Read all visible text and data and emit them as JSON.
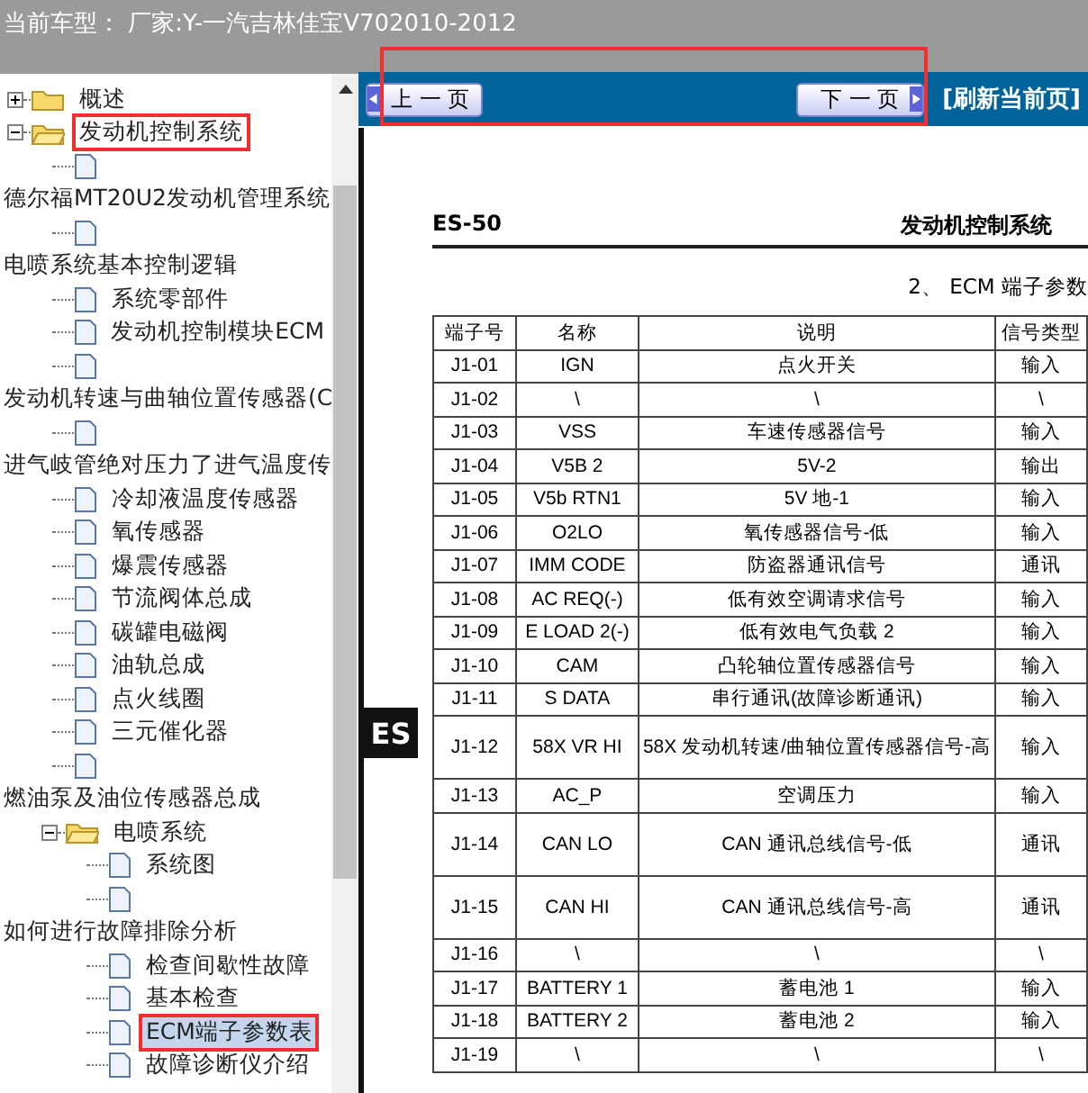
{
  "header": {
    "title": "当前车型： 厂家:Y-一汽吉林佳宝V702010-2012"
  },
  "tree": [
    {
      "kind": "folder",
      "label": "概述",
      "expanded": false,
      "selected": false,
      "highlighted": false
    },
    {
      "kind": "folder",
      "label": "发动机控制系统",
      "expanded": true,
      "selected": false,
      "highlighted": true,
      "children": [
        {
          "kind": "page-break",
          "label": "德尔福MT20U2发动机管理系统",
          "selected": false
        },
        {
          "kind": "page-break",
          "label": "电喷系统基本控制逻辑",
          "selected": false
        },
        {
          "kind": "page",
          "label": "系统零部件",
          "selected": false
        },
        {
          "kind": "page",
          "label": "发动机控制模块ECM",
          "selected": false
        },
        {
          "kind": "page-break",
          "label": "发动机转速与曲轴位置传感器(C",
          "selected": false
        },
        {
          "kind": "page-break",
          "label": "进气岐管绝对压力了进气温度传",
          "selected": false
        },
        {
          "kind": "page",
          "label": "冷却液温度传感器",
          "selected": false
        },
        {
          "kind": "page",
          "label": "氧传感器",
          "selected": false
        },
        {
          "kind": "page",
          "label": "爆震传感器",
          "selected": false
        },
        {
          "kind": "page",
          "label": "节流阀体总成",
          "selected": false
        },
        {
          "kind": "page",
          "label": "碳罐电磁阀",
          "selected": false
        },
        {
          "kind": "page",
          "label": "油轨总成",
          "selected": false
        },
        {
          "kind": "page",
          "label": "点火线圈",
          "selected": false
        },
        {
          "kind": "page",
          "label": "三元催化器",
          "selected": false
        },
        {
          "kind": "page-break",
          "label": "燃油泵及油位传感器总成",
          "selected": false
        },
        {
          "kind": "folder",
          "label": "电喷系统",
          "expanded": true,
          "selected": false,
          "highlighted": false,
          "children": [
            {
              "kind": "page",
              "label": "系统图",
              "selected": false
            },
            {
              "kind": "page-break",
              "label": "如何进行故障排除分析",
              "selected": false
            },
            {
              "kind": "page",
              "label": "检查间歇性故障",
              "selected": false
            },
            {
              "kind": "page",
              "label": "基本检查",
              "selected": false
            },
            {
              "kind": "page",
              "label": "ECM端子参数表",
              "selected": true,
              "highlighted": true
            },
            {
              "kind": "page",
              "label": "故障诊断仪介绍",
              "selected": false
            }
          ]
        }
      ]
    }
  ],
  "nav": {
    "prev": "上 一 页",
    "next": "下 一 页",
    "refresh": "[刷新当前页]",
    "highlighted": true
  },
  "document": {
    "page_code": "ES-50",
    "chapter": "发动机控制系统",
    "section_title": "2、 ECM 端子参数",
    "side_tab": "ES",
    "table": {
      "columns": [
        "端子号",
        "名称",
        "说明",
        "信号类型"
      ],
      "rows": [
        {
          "cells": [
            "J1-01",
            "IGN",
            "点火开关",
            "输入"
          ],
          "tall": false
        },
        {
          "cells": [
            "J1-02",
            "\\",
            "\\",
            "\\"
          ],
          "tall": false
        },
        {
          "cells": [
            "J1-03",
            "VSS",
            "车速传感器信号",
            "输入"
          ],
          "tall": false
        },
        {
          "cells": [
            "J1-04",
            "V5B 2",
            "5V-2",
            "输出"
          ],
          "tall": false
        },
        {
          "cells": [
            "J1-05",
            "V5b RTN1",
            "5V 地-1",
            "输入"
          ],
          "tall": false
        },
        {
          "cells": [
            "J1-06",
            "O2LO",
            "氧传感器信号-低",
            "输入"
          ],
          "tall": false
        },
        {
          "cells": [
            "J1-07",
            "IMM CODE",
            "防盗器通讯信号",
            "通讯"
          ],
          "tall": false
        },
        {
          "cells": [
            "J1-08",
            "AC REQ(-)",
            "低有效空调请求信号",
            "输入"
          ],
          "tall": false
        },
        {
          "cells": [
            "J1-09",
            "E LOAD 2(-)",
            "低有效电气负载 2",
            "输入"
          ],
          "tall": false
        },
        {
          "cells": [
            "J1-10",
            "CAM",
            "凸轮轴位置传感器信号",
            "输入"
          ],
          "tall": false
        },
        {
          "cells": [
            "J1-11",
            "S DATA",
            "串行通讯(故障诊断通讯)",
            "输入"
          ],
          "tall": false
        },
        {
          "cells": [
            "J1-12",
            "58X VR HI",
            "58X 发动机转速/曲轴位置传感器信号-高",
            "输入"
          ],
          "tall": true
        },
        {
          "cells": [
            "J1-13",
            "AC_P",
            "空调压力",
            "输入"
          ],
          "tall": false
        },
        {
          "cells": [
            "J1-14",
            "CAN LO",
            "CAN 通讯总线信号-低",
            "通讯"
          ],
          "tall": true
        },
        {
          "cells": [
            "J1-15",
            "CAN HI",
            "CAN 通讯总线信号-高",
            "通讯"
          ],
          "tall": true
        },
        {
          "cells": [
            "J1-16",
            "\\",
            "\\",
            "\\"
          ],
          "tall": false
        },
        {
          "cells": [
            "J1-17",
            "BATTERY 1",
            "蓄电池 1",
            "输入"
          ],
          "tall": false
        },
        {
          "cells": [
            "J1-18",
            "BATTERY 2",
            "蓄电池 2",
            "输入"
          ],
          "tall": false
        },
        {
          "cells": [
            "J1-19",
            "\\",
            "\\",
            "\\"
          ],
          "tall": false
        }
      ]
    }
  }
}
